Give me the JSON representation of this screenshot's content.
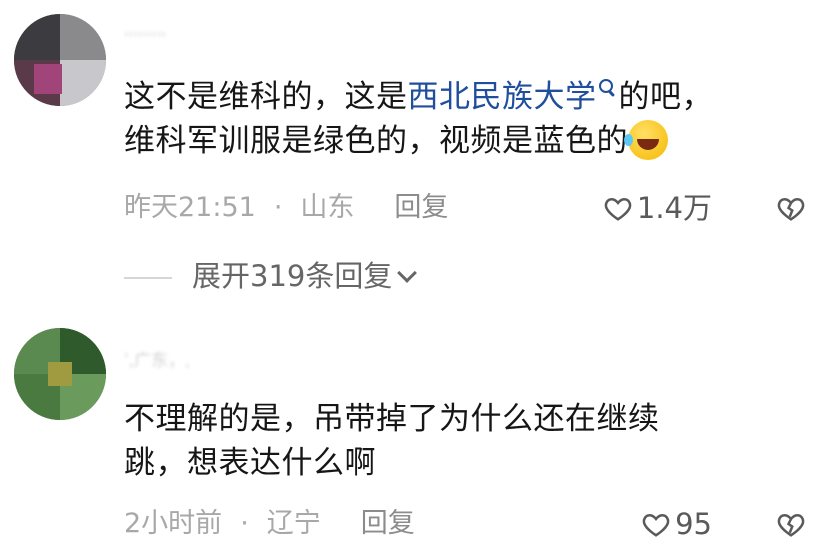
{
  "comments": [
    {
      "username": "ˈˈˈˈˈˈˈˈˈ",
      "text_part1": "这不是维科的，这是",
      "link_text": "西北民族大学",
      "text_part2": "的吧，",
      "text_line2": "维科军训服是绿色的，视频是蓝色的",
      "time": "昨天21:51",
      "separator": "·",
      "location": "山东",
      "reply_label": "回复",
      "like_count": "1.4万",
      "expand_label": "展开319条回复"
    },
    {
      "username": "ˈ,广东，ˌ",
      "text_line1": "不理解的是，吊带掉了为什么还在继续",
      "text_line2": "跳，想表达什么啊",
      "time": "2小时前",
      "separator": "·",
      "location": "辽宁",
      "reply_label": "回复",
      "like_count": "95"
    }
  ],
  "colors": {
    "link": "#1f4e9c",
    "meta": "#a8a8a8",
    "text": "#161616"
  },
  "icons": [
    "search-icon",
    "laughing-emoji-icon",
    "heart-outline-icon",
    "broken-heart-icon",
    "chevron-down-icon"
  ]
}
